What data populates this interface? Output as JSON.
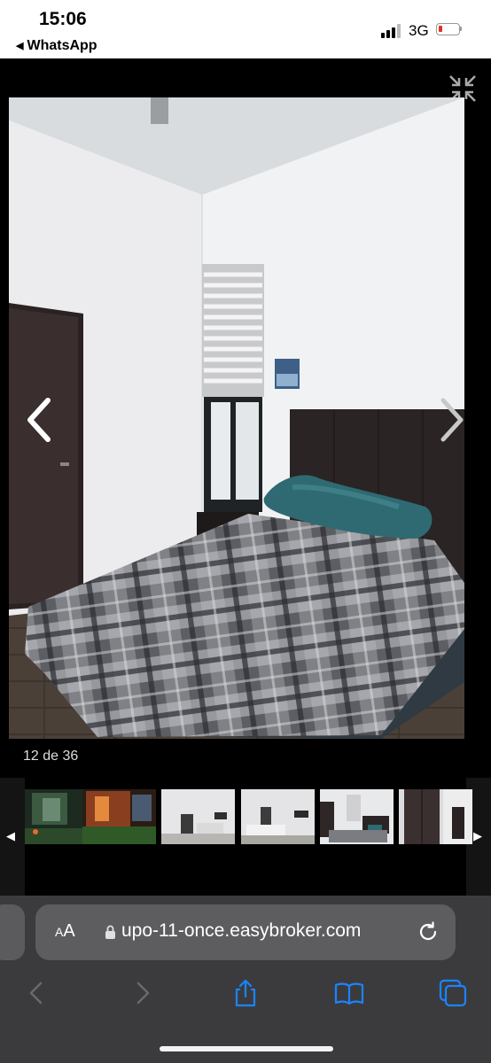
{
  "status_bar": {
    "time": "15:06",
    "back_app": "WhatsApp",
    "network": "3G",
    "battery_icon": "battery-low-icon",
    "battery_color": "#e0302a"
  },
  "gallery": {
    "counter": "12 de 36",
    "current_photo": "bedroom-photo",
    "thumbnails": [
      "exterior-night-1",
      "exterior-night-2",
      "living-room",
      "living-room-2",
      "bedroom",
      "wardrobe"
    ]
  },
  "browser": {
    "text_size_button": "AA",
    "url": "upo-11-once.easybroker.com",
    "accent_color": "#1a84ff",
    "toolbar": [
      "back-icon",
      "forward-icon",
      "share-icon",
      "bookmarks-icon",
      "tabs-icon"
    ]
  }
}
